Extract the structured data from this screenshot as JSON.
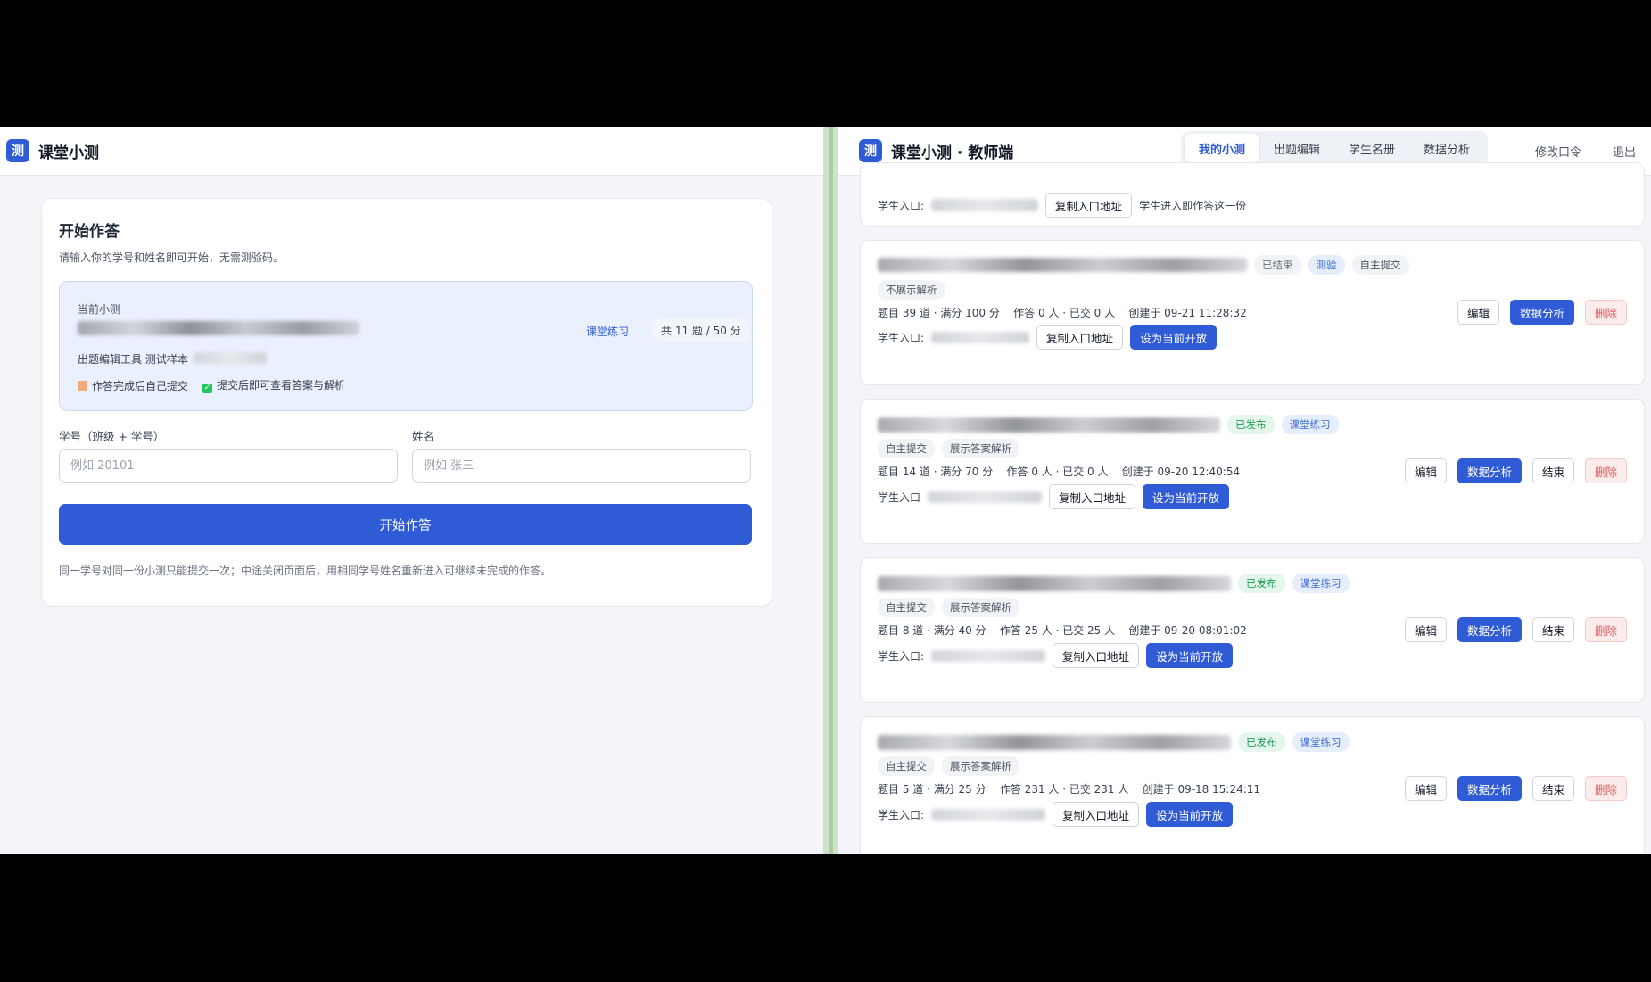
{
  "left": {
    "brand": "课堂小测",
    "logo_char": "测",
    "card": {
      "title": "开始作答",
      "subtitle": "请输入你的学号和姓名即可开始，无需测验码。",
      "current_label": "当前小测",
      "meta": "出题编辑工具 测试样本",
      "flag_self_submit": "作答完成后自己提交",
      "flag_view_answer": "提交后即可查看答案与解析",
      "tag": "课堂练习",
      "count": "共 11 题 / 50 分",
      "student_id_label": "学号（班级 + 学号）",
      "student_id_placeholder": "例如 20101",
      "name_label": "姓名",
      "name_placeholder": "例如 张三",
      "start_button": "开始作答",
      "note": "同一学号对同一份小测只能提交一次；中途关闭页面后，用相同学号姓名重新进入可继续未完成的作答。"
    }
  },
  "right": {
    "brand": "课堂小测 · 教师端",
    "logo_char": "测",
    "tabs": [
      "我的小测",
      "出题编辑",
      "学生名册",
      "数据分析"
    ],
    "change_password": "修改口令",
    "logout": "退出",
    "top_card": {
      "entry_label": "学生入口:",
      "copy_btn": "复制入口地址",
      "note": "学生进入即作答这一份"
    },
    "quizzes": [
      {
        "badges": [
          "已结束",
          "测验",
          "自主提交"
        ],
        "tags": [
          "不展示解析"
        ],
        "stats": "题目 39 道 · 满分 100 分    作答 0 人 · 已交 0 人    创建于 09-21 11:28:32",
        "entry_label": "学生入口:",
        "copy_btn": "复制入口地址",
        "open_btn": "设为当前开放",
        "actions": [
          "编辑",
          "数据分析",
          "删除"
        ]
      },
      {
        "badges": [
          "已发布",
          "课堂练习"
        ],
        "tags": [
          "自主提交",
          "展示答案解析"
        ],
        "stats": "题目 14 道 · 满分 70 分    作答 0 人 · 已交 0 人    创建于 09-20 12:40:54",
        "entry_label": "学生入口",
        "copy_btn": "复制入口地址",
        "open_btn": "设为当前开放",
        "actions": [
          "编辑",
          "数据分析",
          "结束",
          "删除"
        ]
      },
      {
        "badges": [
          "已发布",
          "课堂练习"
        ],
        "tags": [
          "自主提交",
          "展示答案解析"
        ],
        "stats": "题目 8 道 · 满分 40 分    作答 25 人 · 已交 25 人    创建于 09-20 08:01:02",
        "entry_label": "学生入口:",
        "copy_btn": "复制入口地址",
        "open_btn": "设为当前开放",
        "actions": [
          "编辑",
          "数据分析",
          "结束",
          "删除"
        ]
      },
      {
        "badges": [
          "已发布",
          "课堂练习"
        ],
        "tags": [
          "自主提交",
          "展示答案解析"
        ],
        "stats": "题目 5 道 · 满分 25 分    作答 231 人 · 已交 231 人    创建于 09-18 15:24:11",
        "entry_label": "学生入口:",
        "copy_btn": "复制入口地址",
        "open_btn": "设为当前开放",
        "actions": [
          "编辑",
          "数据分析",
          "结束",
          "删除"
        ]
      }
    ]
  }
}
